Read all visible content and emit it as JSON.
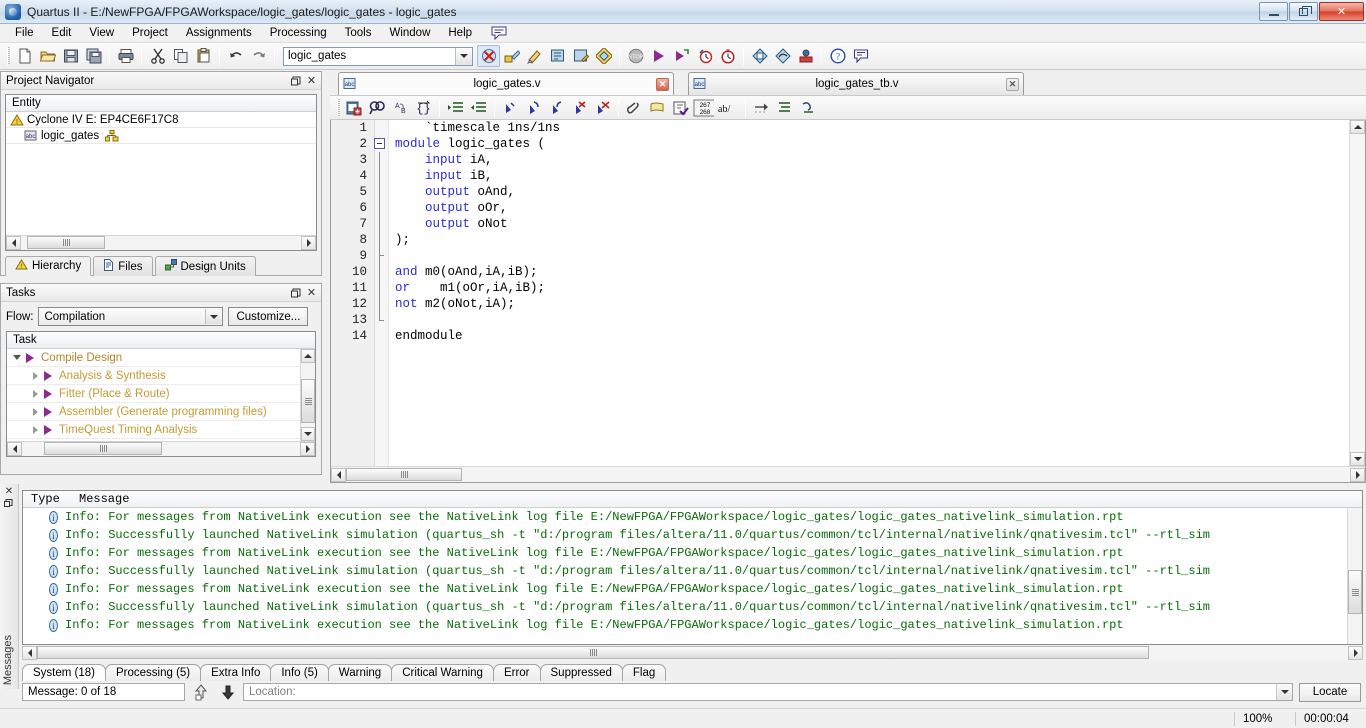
{
  "window": {
    "title": "Quartus II - E:/NewFPGA/FPGAWorkspace/logic_gates/logic_gates - logic_gates",
    "minimize": "–",
    "maximize": "❐",
    "close": "✕"
  },
  "menu": {
    "items": [
      "File",
      "Edit",
      "View",
      "Project",
      "Assignments",
      "Processing",
      "Tools",
      "Window",
      "Help"
    ]
  },
  "toolbar": {
    "project_combo_value": "logic_gates",
    "groups": [
      [
        "new-file-icon",
        "open-file-icon",
        "save-file-icon",
        "save-all-icon"
      ],
      [
        "print-icon"
      ],
      [
        "cut-icon",
        "copy-icon",
        "paste-icon"
      ],
      [
        "undo-icon",
        "redo-icon"
      ]
    ],
    "right_icons": [
      "stop-compilation-icon",
      "pin-planner-icon",
      "assignment-editor-icon",
      "settings-icon",
      "device-icon",
      "compile-icon2",
      "stop-icon",
      "start-compilation-icon",
      "start-analysis-icon",
      "timing-analyzer-icon",
      "timing-analyzer2-icon",
      "rtl-viewer-icon",
      "technology-viewer-icon",
      "programmer-icon",
      "help-icon",
      "message-bubble-icon"
    ]
  },
  "project_navigator": {
    "title": "Project Navigator",
    "column_header": "Entity",
    "rows": [
      {
        "label": "Cyclone IV E: EP4CE6F17C8",
        "icon": "device-warning-icon",
        "indent": 0
      },
      {
        "label": "logic_gates",
        "icon": "verilog-abc-icon",
        "indent": 1,
        "trailing_icon": "hierarchy-icon"
      }
    ],
    "tabs": [
      {
        "label": "Hierarchy",
        "icon": "hierarchy-warning-icon",
        "active": true
      },
      {
        "label": "Files",
        "icon": "files-icon",
        "active": false
      },
      {
        "label": "Design Units",
        "icon": "design-units-icon",
        "active": false
      }
    ]
  },
  "tasks": {
    "title": "Tasks",
    "flow_label": "Flow:",
    "flow_value": "Compilation",
    "customize_label": "Customize...",
    "column_header": "Task",
    "rows": [
      {
        "label": "Compile Design",
        "indent": 0,
        "expanded": true
      },
      {
        "label": "Analysis & Synthesis",
        "indent": 1,
        "expanded": false
      },
      {
        "label": "Fitter (Place & Route)",
        "indent": 1,
        "expanded": false
      },
      {
        "label": "Assembler (Generate programming files)",
        "indent": 1,
        "expanded": false
      },
      {
        "label": "TimeQuest Timing Analysis",
        "indent": 1,
        "expanded": false
      }
    ]
  },
  "editor": {
    "tabs": [
      {
        "label": "logic_gates.v",
        "active": true,
        "icon": "verilog-file-icon",
        "close": "✕"
      },
      {
        "label": "logic_gates_tb.v",
        "active": false,
        "icon": "verilog-file-icon",
        "close": "✕"
      }
    ],
    "toolbar_icons": [
      "insert-template-icon",
      "find-icon",
      "find-replace-icon",
      "match-brace-icon",
      "increase-indent-icon",
      "decrease-indent-icon",
      "bookmark-add-icon",
      "bookmark-next-icon",
      "bookmark-prev-icon",
      "bookmark-clear-icon",
      "bookmark-clear-all-icon",
      "attach-icon",
      "comment-icon",
      "check-syntax-icon",
      "line-numbers-icon",
      "abc-spell-icon",
      "goto-icon",
      "align-icon",
      "undo-format-icon"
    ],
    "line_count_badge": "267\n268",
    "code": [
      {
        "n": 1,
        "fold": "none",
        "segments": [
          {
            "t": "`timescale 1ns/1ns",
            "c": "plain",
            "indent": 4
          }
        ]
      },
      {
        "n": 2,
        "fold": "box",
        "segments": [
          {
            "t": "module",
            "c": "kw"
          },
          {
            "t": " logic_gates (",
            "c": "plain"
          }
        ]
      },
      {
        "n": 3,
        "fold": "bar",
        "segments": [
          {
            "t": "    ",
            "c": "plain"
          },
          {
            "t": "input",
            "c": "kw"
          },
          {
            "t": " iA,",
            "c": "plain"
          }
        ]
      },
      {
        "n": 4,
        "fold": "bar",
        "segments": [
          {
            "t": "    ",
            "c": "plain"
          },
          {
            "t": "input",
            "c": "kw"
          },
          {
            "t": " iB,",
            "c": "plain"
          }
        ]
      },
      {
        "n": 5,
        "fold": "bar",
        "segments": [
          {
            "t": "    ",
            "c": "plain"
          },
          {
            "t": "output",
            "c": "kw"
          },
          {
            "t": " oAnd,",
            "c": "plain"
          }
        ]
      },
      {
        "n": 6,
        "fold": "bar",
        "segments": [
          {
            "t": "    ",
            "c": "plain"
          },
          {
            "t": "output",
            "c": "kw"
          },
          {
            "t": " oOr,",
            "c": "plain"
          }
        ]
      },
      {
        "n": 7,
        "fold": "bar",
        "segments": [
          {
            "t": "    ",
            "c": "plain"
          },
          {
            "t": "output",
            "c": "kw"
          },
          {
            "t": " oNot",
            "c": "plain"
          }
        ]
      },
      {
        "n": 8,
        "fold": "bar",
        "segments": [
          {
            "t": ");",
            "c": "plain"
          }
        ]
      },
      {
        "n": 9,
        "fold": "tick",
        "segments": [
          {
            "t": "",
            "c": "plain"
          }
        ]
      },
      {
        "n": 10,
        "fold": "bar",
        "segments": [
          {
            "t": "and",
            "c": "kw"
          },
          {
            "t": " m0(oAnd,iA,iB);",
            "c": "plain"
          }
        ]
      },
      {
        "n": 11,
        "fold": "bar",
        "segments": [
          {
            "t": "or",
            "c": "kw"
          },
          {
            "t": "    m1(oOr,iA,iB);",
            "c": "plain"
          }
        ]
      },
      {
        "n": 12,
        "fold": "bar",
        "segments": [
          {
            "t": "not",
            "c": "kw"
          },
          {
            "t": " m2(oNot,iA);",
            "c": "plain"
          }
        ]
      },
      {
        "n": 13,
        "fold": "end",
        "segments": [
          {
            "t": "",
            "c": "plain"
          }
        ]
      },
      {
        "n": 14,
        "fold": "none",
        "segments": [
          {
            "t": "endmodule",
            "c": "plain"
          }
        ]
      }
    ]
  },
  "messages": {
    "panel_label": "Messages",
    "columns": {
      "type": "Type",
      "message": "Message"
    },
    "rows": [
      {
        "icon": "info-icon",
        "text": "Info: For messages from NativeLink execution see the NativeLink log file E:/NewFPGA/FPGAWorkspace/logic_gates/logic_gates_nativelink_simulation.rpt"
      },
      {
        "icon": "info-icon",
        "text": "Info: Successfully launched NativeLink simulation (quartus_sh -t \"d:/program files/altera/11.0/quartus/common/tcl/internal/nativelink/qnativesim.tcl\" --rtl_sim"
      },
      {
        "icon": "info-icon",
        "text": "Info: For messages from NativeLink execution see the NativeLink log file E:/NewFPGA/FPGAWorkspace/logic_gates/logic_gates_nativelink_simulation.rpt"
      },
      {
        "icon": "info-icon",
        "text": "Info: Successfully launched NativeLink simulation (quartus_sh -t \"d:/program files/altera/11.0/quartus/common/tcl/internal/nativelink/qnativesim.tcl\" --rtl_sim"
      },
      {
        "icon": "info-icon",
        "text": "Info: For messages from NativeLink execution see the NativeLink log file E:/NewFPGA/FPGAWorkspace/logic_gates/logic_gates_nativelink_simulation.rpt"
      },
      {
        "icon": "info-icon",
        "text": "Info: Successfully launched NativeLink simulation (quartus_sh -t \"d:/program files/altera/11.0/quartus/common/tcl/internal/nativelink/qnativesim.tcl\" --rtl_sim"
      },
      {
        "icon": "info-icon",
        "text": "Info: For messages from NativeLink execution see the NativeLink log file E:/NewFPGA/FPGAWorkspace/logic_gates/logic_gates_nativelink_simulation.rpt"
      }
    ],
    "tabs": [
      {
        "label": "System (18)",
        "active": true
      },
      {
        "label": "Processing (5)",
        "active": false
      },
      {
        "label": "Extra Info",
        "active": false
      },
      {
        "label": "Info (5)",
        "active": false
      },
      {
        "label": "Warning",
        "active": false
      },
      {
        "label": "Critical Warning",
        "active": false
      },
      {
        "label": "Error",
        "active": false
      },
      {
        "label": "Suppressed",
        "active": false
      },
      {
        "label": "Flag",
        "active": false
      }
    ],
    "status": {
      "message_counter": "Message: 0 of 18",
      "location_label": "Location:",
      "location_value": "",
      "locate_button": "Locate"
    }
  },
  "statusbar": {
    "zoom": "100%",
    "elapsed": "00:00:04"
  },
  "colors": {
    "keyword": "#2b2bd6",
    "info_text": "#0a6b0a",
    "task_text": "#c89a33",
    "play_marker": "#8e2a8e",
    "titlebar_close": "#d4402a"
  }
}
